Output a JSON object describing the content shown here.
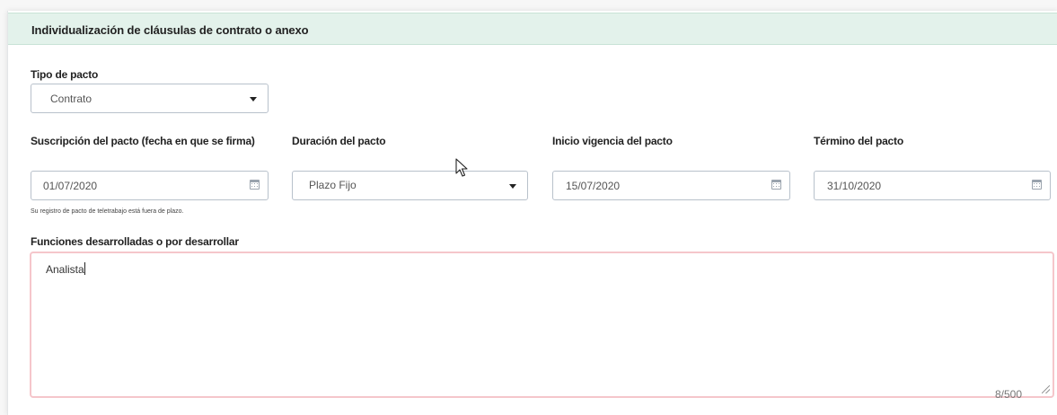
{
  "section": {
    "title": "Individualización de cláusulas de contrato o anexo"
  },
  "tipo_pacto": {
    "label": "Tipo de pacto",
    "value": "Contrato"
  },
  "suscripcion": {
    "label": "Suscripción del pacto (fecha en que se firma)",
    "value": "01/07/2020",
    "hint": "Su registro de pacto de teletrabajo está fuera de plazo."
  },
  "duracion": {
    "label": "Duración del pacto",
    "value": "Plazo Fijo"
  },
  "inicio": {
    "label": "Inicio vigencia del pacto",
    "value": "15/07/2020"
  },
  "termino": {
    "label": "Término del pacto",
    "value": "31/10/2020"
  },
  "funciones": {
    "label": "Funciones desarrolladas o por desarrollar",
    "value": "Analista",
    "counter": "8/500"
  },
  "colors": {
    "header_bg": "#e3f2eb",
    "textarea_border": "#f5c6cb",
    "field_border": "#b8c1cb"
  },
  "icons": [
    "caret-down-icon",
    "calendar-icon",
    "resize-handle-icon",
    "mouse-pointer-icon"
  ]
}
